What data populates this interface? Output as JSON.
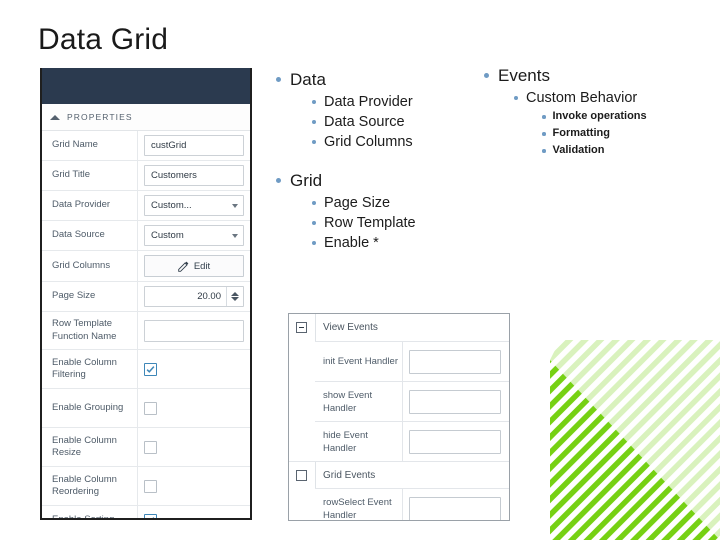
{
  "slide": {
    "title": "Data Grid"
  },
  "colors": {
    "panel_header_navy": "#2b3a4f",
    "bullet_blue": "#6f9bc4",
    "checkbox_accent": "#3e87b8",
    "stripe_green": "#76d113"
  },
  "properties_panel": {
    "section_title": "PROPERTIES",
    "collapse_icon": "caret-up-icon",
    "rows": [
      {
        "label": "Grid Name",
        "control": "text",
        "value": "custGrid"
      },
      {
        "label": "Grid Title",
        "control": "text",
        "value": "Customers"
      },
      {
        "label": "Data Provider",
        "control": "select",
        "value": "Custom..."
      },
      {
        "label": "Data Source",
        "control": "select",
        "value": "Custom"
      },
      {
        "label": "Grid Columns",
        "control": "button",
        "value": "Edit"
      },
      {
        "label": "Page Size",
        "control": "spinner",
        "value": "20.00"
      },
      {
        "label": "Row Template Function Name",
        "control": "text",
        "value": ""
      },
      {
        "label": "Enable Column Filtering",
        "control": "checkbox",
        "checked": true
      },
      {
        "label": "Enable Grouping",
        "control": "checkbox",
        "checked": false
      },
      {
        "label": "Enable Column Resize",
        "control": "checkbox",
        "checked": false
      },
      {
        "label": "Enable Column Reordering",
        "control": "checkbox",
        "checked": false
      },
      {
        "label": "Enable Sorting",
        "control": "checkbox",
        "checked": true
      }
    ]
  },
  "bullets_center": {
    "groups": [
      {
        "heading": "Data",
        "items": [
          "Data Provider",
          "Data Source",
          "Grid Columns"
        ]
      },
      {
        "heading": "Grid",
        "items": [
          "Page Size",
          "Row Template",
          "Enable *"
        ]
      }
    ]
  },
  "bullets_right": {
    "heading": "Events",
    "sub_heading": "Custom Behavior",
    "items": [
      "Invoke operations",
      "Formatting",
      "Validation"
    ]
  },
  "events_panel": {
    "groups": [
      {
        "title": "View Events",
        "toggle": "minus",
        "rows": [
          {
            "label": "init Event Handler",
            "value": ""
          },
          {
            "label": "show Event Handler",
            "value": ""
          },
          {
            "label": "hide Event Handler",
            "value": ""
          }
        ]
      },
      {
        "title": "Grid Events",
        "toggle": "empty",
        "rows": [
          {
            "label": "rowSelect Event Handler",
            "value": ""
          }
        ]
      }
    ]
  }
}
